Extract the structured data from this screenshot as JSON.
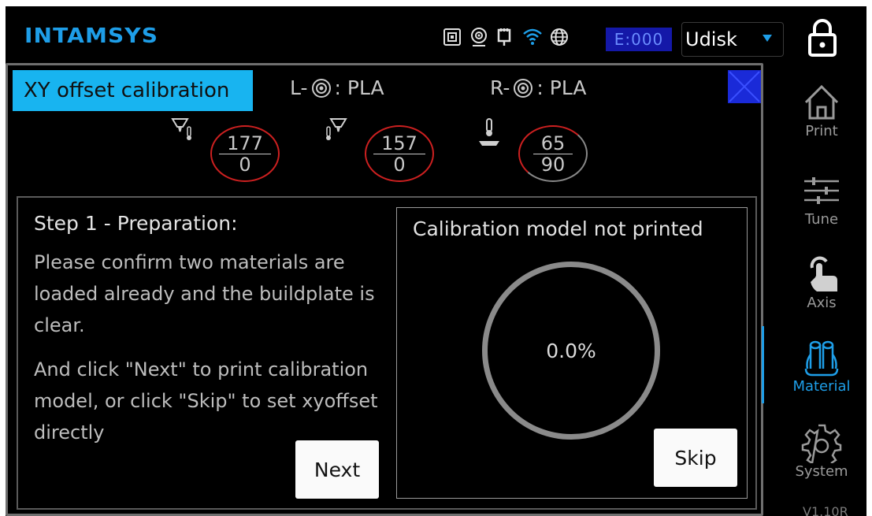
{
  "header": {
    "logo": "INTAMSYS",
    "error_count": "E:000",
    "storage_select": "Udisk",
    "status_icons": [
      "sd-card-icon",
      "webcam-icon",
      "ethernet-icon",
      "wifi-icon",
      "globe-icon"
    ]
  },
  "panel": {
    "title": "XY offset calibration",
    "left_material": {
      "prefix": "L-",
      "material": ": PLA"
    },
    "right_material": {
      "prefix": "R-",
      "material": ": PLA"
    },
    "temps": [
      {
        "current": "177",
        "target": "0"
      },
      {
        "current": "157",
        "target": "0"
      },
      {
        "current": "65",
        "target": "90"
      }
    ]
  },
  "step": {
    "title": "Step 1 - Preparation:",
    "paragraph1": "Please confirm two materials are loaded already and the buildplate is clear.",
    "paragraph2": "And click \"Next\" to print calibration model, or click \"Skip\" to set xyoffset directly",
    "next_label": "Next"
  },
  "calibration": {
    "status": "Calibration model not printed",
    "progress": "0.0%",
    "skip_label": "Skip"
  },
  "sidebar": {
    "items": [
      {
        "label": "Print",
        "icon": "home-icon"
      },
      {
        "label": "Tune",
        "icon": "sliders-icon"
      },
      {
        "label": "Axis",
        "icon": "hand-icon"
      },
      {
        "label": "Material",
        "icon": "spools-icon",
        "active": true
      },
      {
        "label": "System",
        "icon": "gear-icon"
      }
    ],
    "version": "V1.10R"
  },
  "colors": {
    "accent": "#1e9ee8",
    "title_bg": "#18b4f0",
    "heat": "#cc2020"
  }
}
